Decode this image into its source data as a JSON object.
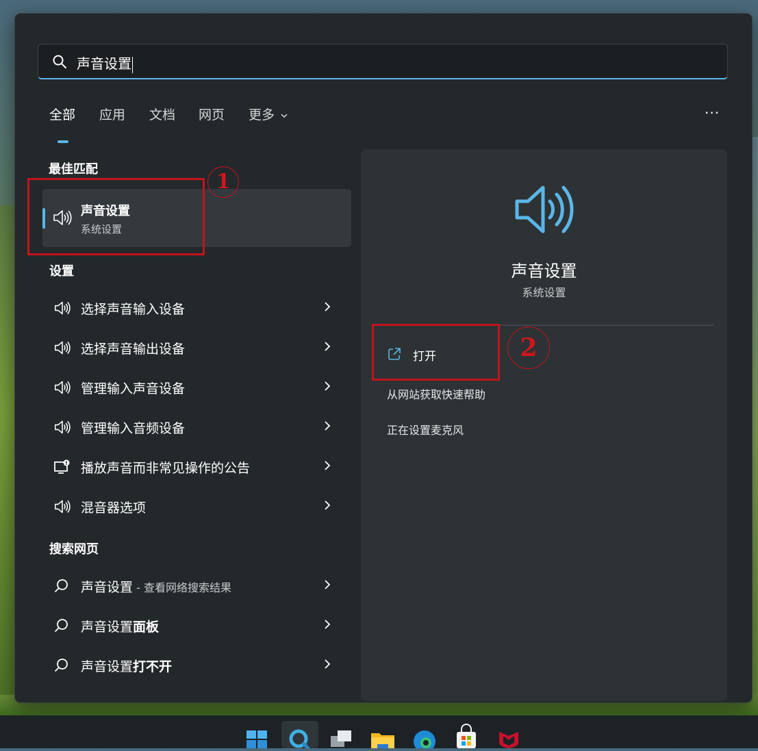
{
  "search": {
    "query": "声音设置"
  },
  "tabs": [
    {
      "label": "全部"
    },
    {
      "label": "应用"
    },
    {
      "label": "文档"
    },
    {
      "label": "网页"
    },
    {
      "label": "更多"
    }
  ],
  "more_menu_label": "···",
  "best_match": {
    "heading": "最佳匹配",
    "title": "声音设置",
    "subtitle": "系统设置",
    "icon": "speaker-icon"
  },
  "settings": {
    "heading": "设置",
    "items": [
      {
        "label": "选择声音输入设备",
        "icon": "speaker-icon"
      },
      {
        "label": "选择声音输出设备",
        "icon": "speaker-icon"
      },
      {
        "label": "管理输入声音设备",
        "icon": "speaker-icon"
      },
      {
        "label": "管理输入音频设备",
        "icon": "speaker-icon"
      },
      {
        "label": "播放声音而非常见操作的公告",
        "icon": "notification-monitor-icon"
      },
      {
        "label": "混音器选项",
        "icon": "speaker-icon"
      }
    ]
  },
  "web": {
    "heading": "搜索网页",
    "items": [
      {
        "label": "声音设置",
        "suffix": " - 查看网络搜索结果",
        "bold": ""
      },
      {
        "label": "声音设置",
        "suffix": "",
        "bold": "面板"
      },
      {
        "label": "声音设置",
        "suffix": "",
        "bold": "打不开"
      }
    ]
  },
  "preview": {
    "title": "声音设置",
    "subtitle": "系统设置",
    "open_label": "打开",
    "links": [
      "从网站获取快速帮助",
      "正在设置麦克风"
    ]
  },
  "annotations": {
    "marker1": "1",
    "marker2": "2"
  },
  "colors": {
    "accent": "#5bb6e8",
    "annotation_red": "#c3141b",
    "panel": "#23282b"
  },
  "taskbar_icons": [
    "windows-start-icon",
    "search-icon",
    "task-view-icon",
    "file-explorer-icon",
    "edge-icon",
    "store-icon",
    "mcafee-icon"
  ]
}
